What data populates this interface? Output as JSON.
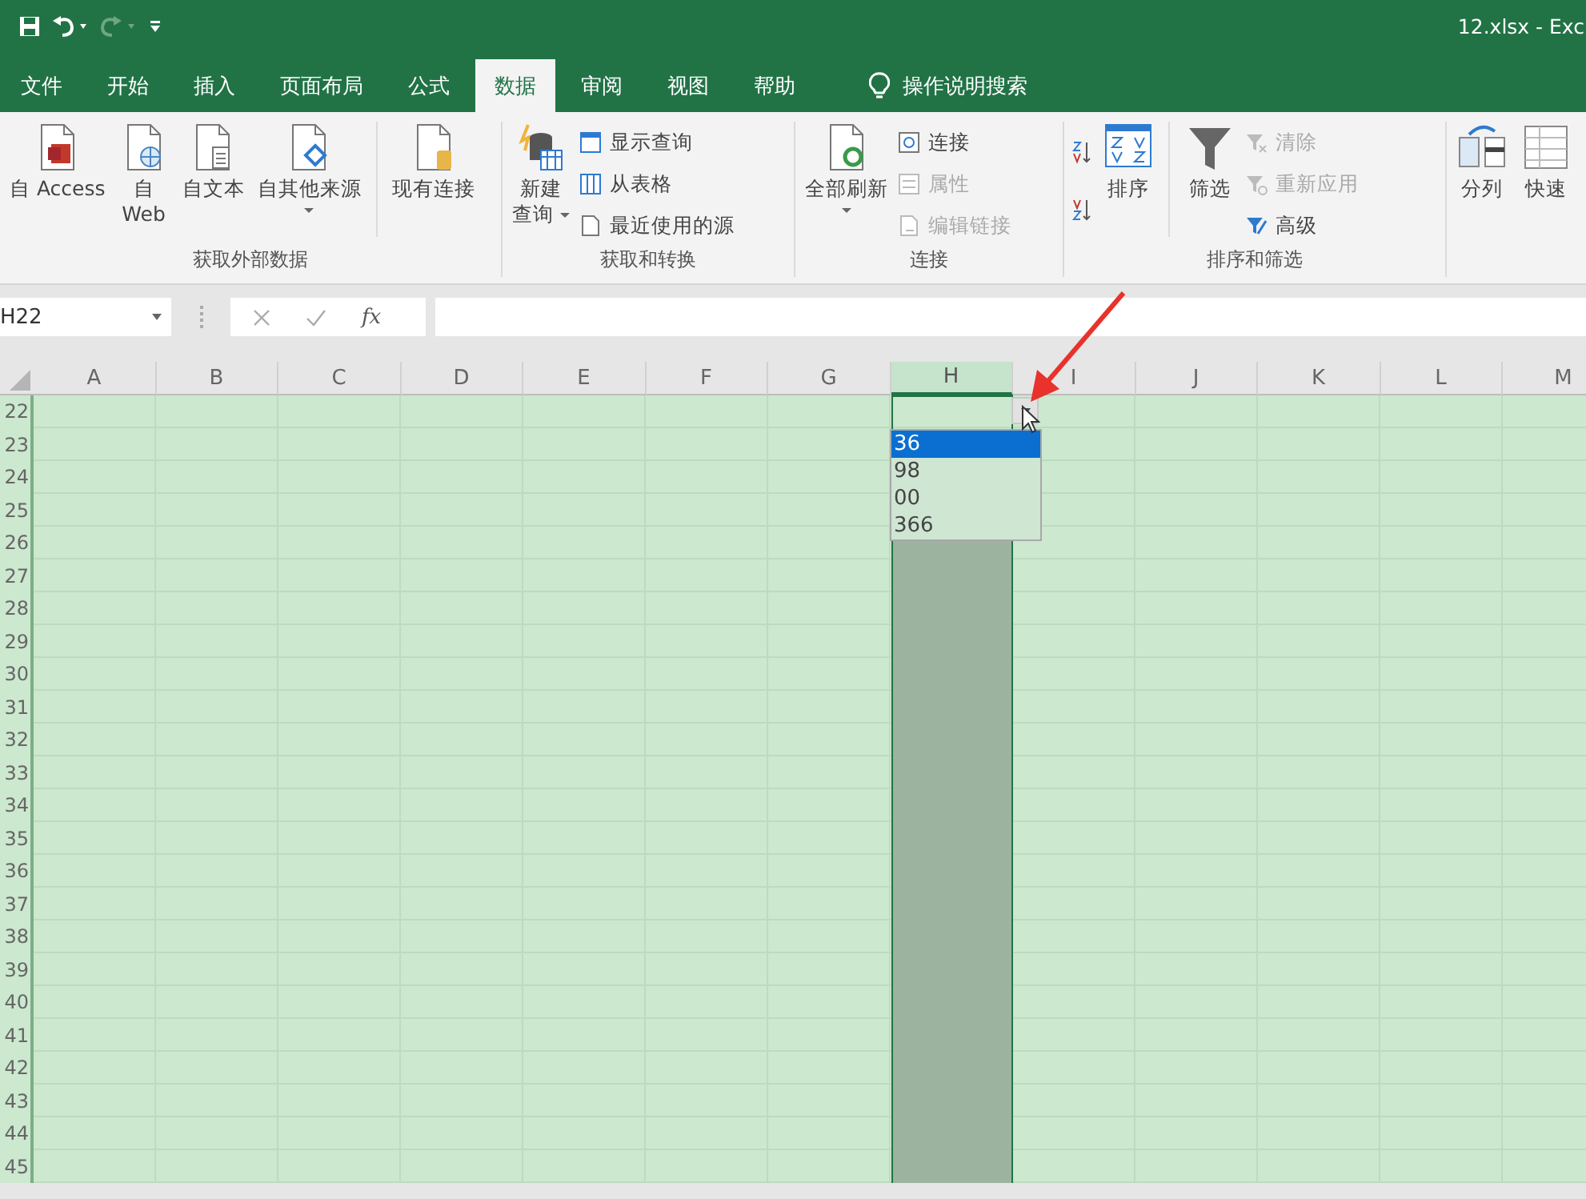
{
  "title_bar": {
    "quick_access": [
      {
        "kind": "save",
        "disabled": false
      },
      {
        "kind": "undo",
        "disabled": false
      },
      {
        "kind": "redo",
        "disabled": true
      },
      {
        "kind": "customize",
        "disabled": false
      }
    ],
    "title": "12.xlsx - Exc"
  },
  "tabs": [
    {
      "label": "文件",
      "selected": false
    },
    {
      "label": "开始",
      "selected": false
    },
    {
      "label": "插入",
      "selected": false
    },
    {
      "label": "页面布局",
      "selected": false
    },
    {
      "label": "公式",
      "selected": false
    },
    {
      "label": "数据",
      "selected": true
    },
    {
      "label": "审阅",
      "selected": false
    },
    {
      "label": "视图",
      "selected": false
    },
    {
      "label": "帮助",
      "selected": false
    }
  ],
  "tell_me": {
    "placeholder": "操作说明搜索"
  },
  "ribbon": {
    "groups": [
      {
        "label": "获取外部数据",
        "items": [
          {
            "kind": "large",
            "label": "自 Access",
            "disabled": false,
            "dropdown": false
          },
          {
            "kind": "large",
            "label": [
              "自",
              "Web"
            ],
            "disabled": false,
            "dropdown": false
          },
          {
            "kind": "large",
            "label": "自文本",
            "disabled": false,
            "dropdown": false
          },
          {
            "kind": "large",
            "label": "自其他来源",
            "disabled": false,
            "dropdown": true
          },
          {
            "kind": "separator"
          },
          {
            "kind": "large",
            "label": "现有连接",
            "disabled": false,
            "dropdown": false
          }
        ]
      },
      {
        "label": "获取和转换",
        "items": [
          {
            "kind": "large",
            "label": [
              "新建",
              "查询"
            ],
            "disabled": false,
            "dropdown": true
          },
          {
            "kind": "small",
            "label": "显示查询",
            "disabled": false
          },
          {
            "kind": "small",
            "label": "从表格",
            "disabled": false
          },
          {
            "kind": "small",
            "label": "最近使用的源",
            "disabled": false
          }
        ]
      },
      {
        "label": "连接",
        "items": [
          {
            "kind": "large",
            "label": "全部刷新",
            "disabled": false,
            "dropdown": true
          },
          {
            "kind": "small",
            "label": "连接",
            "disabled": false
          },
          {
            "kind": "small",
            "label": "属性",
            "disabled": true
          },
          {
            "kind": "small",
            "label": "编辑链接",
            "disabled": true
          }
        ]
      },
      {
        "label": "排序和筛选",
        "items": [
          {
            "kind": "icon",
            "disabled": false
          },
          {
            "kind": "icon",
            "disabled": false
          },
          {
            "kind": "large",
            "label": "排序",
            "disabled": false,
            "dropdown": false
          },
          {
            "kind": "separator"
          },
          {
            "kind": "large",
            "label": "筛选",
            "disabled": false,
            "dropdown": false
          },
          {
            "kind": "small",
            "label": "清除",
            "disabled": true
          },
          {
            "kind": "small",
            "label": "重新应用",
            "disabled": true
          },
          {
            "kind": "small",
            "label": "高级",
            "disabled": false
          }
        ]
      },
      {
        "items": [
          {
            "kind": "large",
            "label": "分列",
            "disabled": false,
            "dropdown": false
          },
          {
            "kind": "large",
            "label": "快速",
            "disabled": false,
            "dropdown": false
          }
        ]
      }
    ]
  },
  "formula_bar": {
    "name_box": "H22",
    "fx_label": "fx"
  },
  "grid": {
    "columns": [
      {
        "label": "A",
        "selected": false
      },
      {
        "label": "B",
        "selected": false
      },
      {
        "label": "C",
        "selected": false
      },
      {
        "label": "D",
        "selected": false
      },
      {
        "label": "E",
        "selected": false
      },
      {
        "label": "F",
        "selected": false
      },
      {
        "label": "G",
        "selected": false
      },
      {
        "label": "H",
        "selected": true
      },
      {
        "label": "I",
        "selected": false
      },
      {
        "label": "J",
        "selected": false
      },
      {
        "label": "K",
        "selected": false
      },
      {
        "label": "L",
        "selected": false
      },
      {
        "label": "M",
        "selected": false
      }
    ],
    "rows": [
      "22",
      "23",
      "24",
      "25",
      "26",
      "27",
      "28",
      "29",
      "30",
      "31",
      "32",
      "33",
      "34",
      "35",
      "36",
      "37",
      "38",
      "39",
      "40",
      "41",
      "42",
      "43",
      "44",
      "45"
    ],
    "dropdown_list": [
      {
        "label": "36",
        "selected": true
      },
      {
        "label": "98",
        "selected": false
      },
      {
        "label": "00",
        "selected": false
      },
      {
        "label": "366",
        "selected": false
      }
    ]
  }
}
